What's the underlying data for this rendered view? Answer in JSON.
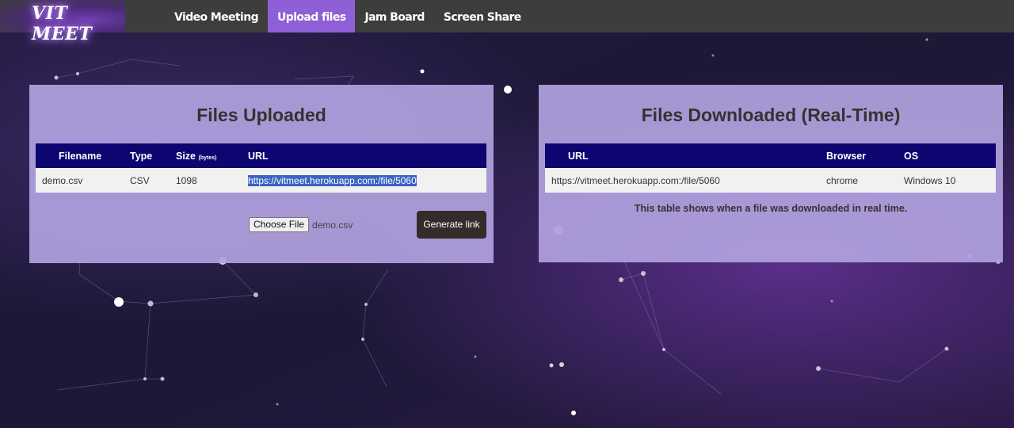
{
  "app": {
    "logo_text": "VIT MEET"
  },
  "nav": {
    "items": [
      {
        "label": "Video Meeting",
        "active": false
      },
      {
        "label": "Upload files",
        "active": true
      },
      {
        "label": "Jam Board",
        "active": false
      },
      {
        "label": "Screen Share",
        "active": false
      }
    ]
  },
  "uploaded": {
    "title": "Files Uploaded",
    "headers": {
      "filename": "Filename",
      "type": "Type",
      "size": "Size",
      "size_unit": "(bytes)",
      "url": "URL"
    },
    "rows": [
      {
        "filename": "demo.csv",
        "type": "CSV",
        "size": "1098",
        "url": "https://vitmeet.herokuapp.com:/file/5060"
      }
    ],
    "choose_file_label": "Choose File",
    "chosen_file": "demo.csv",
    "generate_label": "Generate link"
  },
  "downloaded": {
    "title": "Files Downloaded (Real-Time)",
    "headers": {
      "url": "URL",
      "browser": "Browser",
      "os": "OS"
    },
    "rows": [
      {
        "url": "https://vitmeet.herokuapp.com:/file/5060",
        "browser": "chrome",
        "os": "Windows 10"
      }
    ],
    "note": "This table shows when a file was downloaded in real time."
  },
  "colors": {
    "nav_bg": "#3d3d3d",
    "nav_active": "#8e5fd6",
    "panel_bg": "#b0a0de",
    "table_header": "#0d0570",
    "button_dark": "#352b2b"
  }
}
